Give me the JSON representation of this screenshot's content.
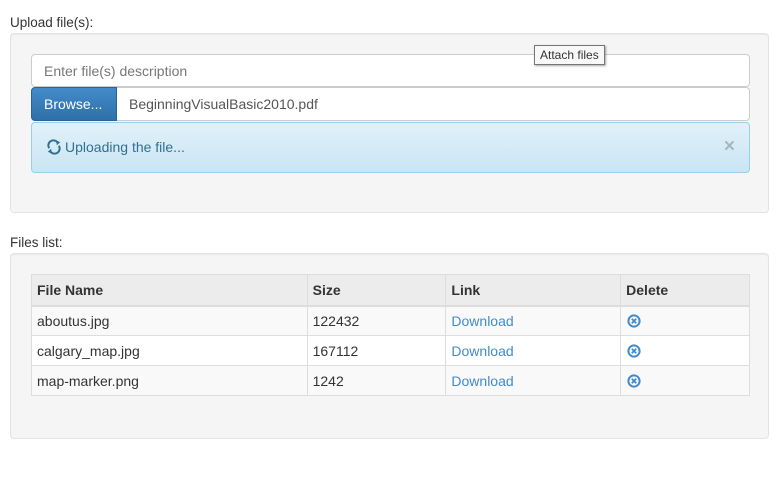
{
  "upload": {
    "label": "Upload file(s):",
    "description_placeholder": "Enter file(s) description",
    "description_value": "",
    "tooltip": "Attach files",
    "browse_label": "Browse...",
    "selected_file": "BeginningVisualBasic2010.pdf",
    "status_text": "Uploading the file...",
    "status_icon": "refresh-icon",
    "close_glyph": "×"
  },
  "files": {
    "label": "Files list:",
    "columns": [
      "File Name",
      "Size",
      "Link",
      "Delete"
    ],
    "rows": [
      {
        "name": "aboutus.jpg",
        "size": "122432",
        "link": "Download",
        "delete_icon": "remove-circle-icon"
      },
      {
        "name": "calgary_map.jpg",
        "size": "167112",
        "link": "Download",
        "delete_icon": "remove-circle-icon"
      },
      {
        "name": "map-marker.png",
        "size": "1242",
        "link": "Download",
        "delete_icon": "remove-circle-icon"
      }
    ]
  },
  "colors": {
    "primary": "#428bca",
    "info_bg": "#d9edf7",
    "info_text": "#31708f",
    "well_bg": "#f5f5f5"
  }
}
